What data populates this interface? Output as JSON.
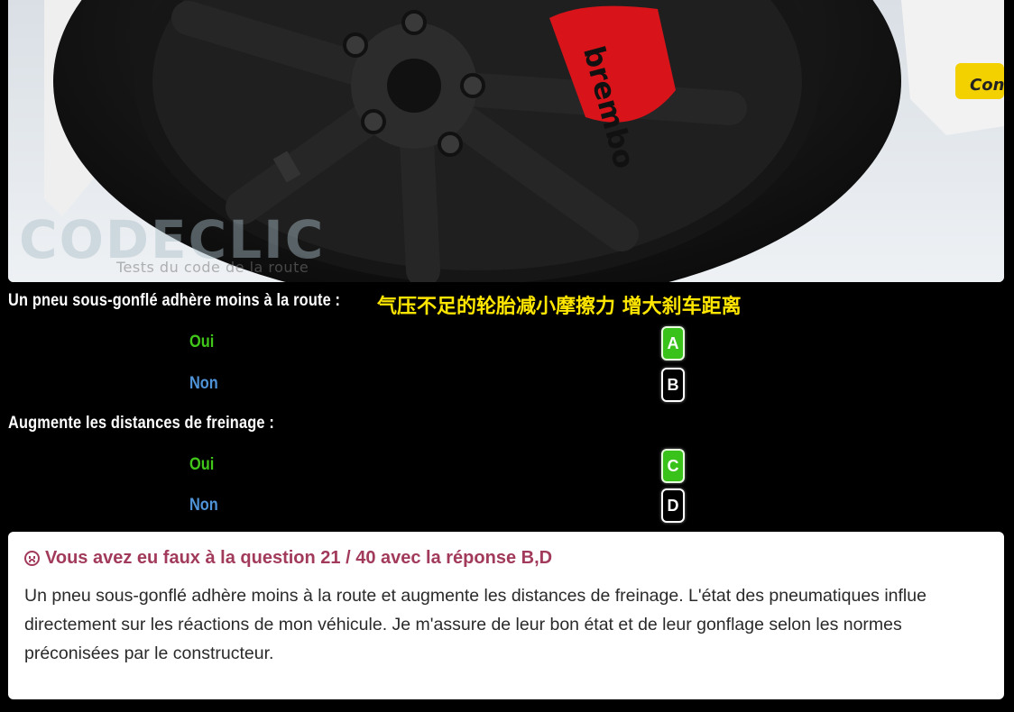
{
  "photo": {
    "watermark_logo": "CODECLIC",
    "watermark_caption": "Tests du code de la route",
    "caliper_brand": "brembo",
    "sidewall_brand": "Conti"
  },
  "questions": [
    {
      "text": "Un pneu sous-gonflé adhère moins à la route :",
      "translation": "气压不足的轮胎减小摩擦力 增大刹车距离",
      "options": [
        {
          "label": "Oui",
          "letter": "A",
          "state": "correct"
        },
        {
          "label": "Non",
          "letter": "B",
          "state": "wrong"
        }
      ]
    },
    {
      "text": "Augmente les distances de freinage :",
      "options": [
        {
          "label": "Oui",
          "letter": "C",
          "state": "correct"
        },
        {
          "label": "Non",
          "letter": "D",
          "state": "wrong"
        }
      ]
    }
  ],
  "result": {
    "icon": "frown-icon",
    "title": "Vous avez eu faux à la question 21 / 40 avec la réponse B,D",
    "explanation": "Un pneu sous-gonflé adhère moins à la route et augmente les distances de freinage. L'état des pneumatiques influe directement sur les réactions de mon véhicule. Je m'assure de leur bon état et de leur gonflage selon les normes préconisées par le constructeur."
  },
  "colors": {
    "correct": "#39c21a",
    "oui_text": "#41c71a",
    "non_text": "#4f93d8",
    "translation": "#ffe600",
    "error_title": "#a23b5b"
  }
}
